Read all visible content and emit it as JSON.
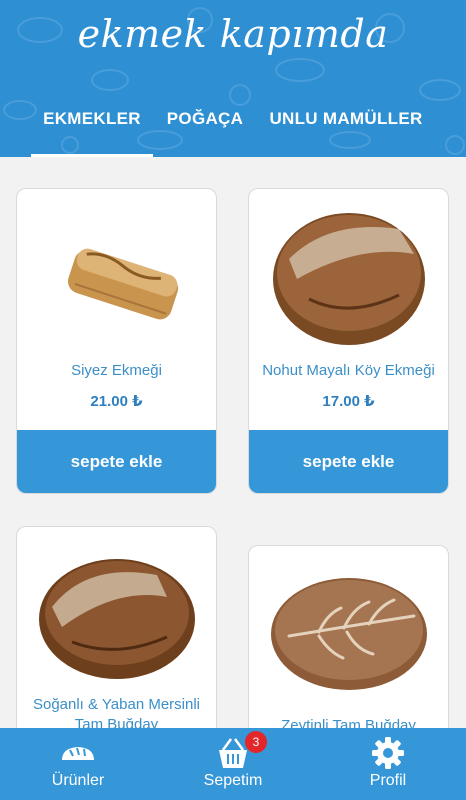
{
  "header": {
    "logo": "ekmek kapımda",
    "brand_color": "#2e8fd3"
  },
  "tabs": [
    {
      "label": "EKMEKLER",
      "active": true
    },
    {
      "label": "POĞAÇA",
      "active": false
    },
    {
      "label": "UNLU MAMÜLLER",
      "active": false
    }
  ],
  "products": [
    {
      "name": "Siyez Ekmeği",
      "price": "21.00 ₺",
      "button": "sepete ekle",
      "image": "siyez-bread-loaf"
    },
    {
      "name": "Nohut Mayalı Köy Ekmeği",
      "price": "17.00 ₺",
      "button": "sepete ekle",
      "image": "round-village-bread"
    },
    {
      "name": "Soğanlı & Yaban Mersinli Tam Buğday",
      "price": "",
      "button": "",
      "image": "round-whole-wheat-bread"
    },
    {
      "name": "Zeytinli Tam Buğday",
      "price": "",
      "button": "",
      "image": "olive-whole-wheat-bread"
    }
  ],
  "bottom_nav": {
    "items": [
      {
        "label": "Ürünler",
        "icon": "bread-icon"
      },
      {
        "label": "Sepetim",
        "icon": "basket-icon",
        "badge": "3"
      },
      {
        "label": "Profil",
        "icon": "gear-icon"
      }
    ],
    "badge_color": "#e2262a"
  }
}
